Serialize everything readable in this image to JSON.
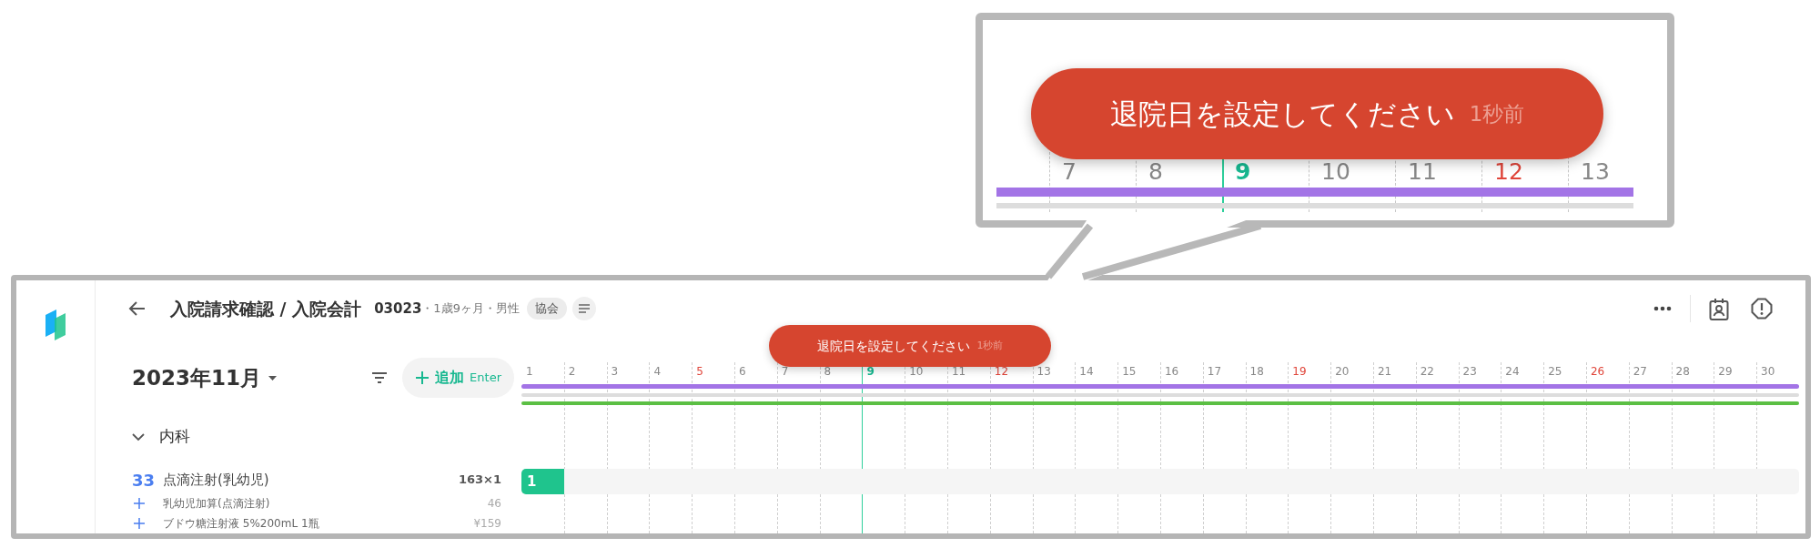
{
  "zoom_callout": {
    "toast": {
      "message": "退院日を設定してください",
      "time": "1秒前"
    },
    "days": [
      {
        "label": "7",
        "kind": "weekday"
      },
      {
        "label": "8",
        "kind": "weekday"
      },
      {
        "label": "9",
        "kind": "today"
      },
      {
        "label": "10",
        "kind": "weekday"
      },
      {
        "label": "11",
        "kind": "weekday"
      },
      {
        "label": "12",
        "kind": "holiday"
      },
      {
        "label": "13",
        "kind": "weekday"
      }
    ],
    "bars": [
      {
        "color": "#a374e6"
      },
      {
        "color": "#dddddd"
      }
    ]
  },
  "app": {
    "header": {
      "title": "入院請求確認 / 入院会計",
      "patient_id": "03023",
      "patient_info": "・1歳9ヶ月・男性",
      "badge": "協会"
    },
    "toast": {
      "message": "退院日を設定してください",
      "time": "1秒前"
    },
    "toolbar": {
      "month": "2023年11月",
      "add_button": {
        "label": "追加",
        "shortcut": "Enter"
      }
    },
    "days": [
      {
        "label": "1",
        "kind": "weekday"
      },
      {
        "label": "2",
        "kind": "weekday"
      },
      {
        "label": "3",
        "kind": "weekday"
      },
      {
        "label": "4",
        "kind": "weekday"
      },
      {
        "label": "5",
        "kind": "holiday"
      },
      {
        "label": "6",
        "kind": "weekday"
      },
      {
        "label": "7",
        "kind": "weekday"
      },
      {
        "label": "8",
        "kind": "weekday"
      },
      {
        "label": "9",
        "kind": "today"
      },
      {
        "label": "10",
        "kind": "weekday"
      },
      {
        "label": "11",
        "kind": "weekday"
      },
      {
        "label": "12",
        "kind": "holiday"
      },
      {
        "label": "13",
        "kind": "weekday"
      },
      {
        "label": "14",
        "kind": "weekday"
      },
      {
        "label": "15",
        "kind": "weekday"
      },
      {
        "label": "16",
        "kind": "weekday"
      },
      {
        "label": "17",
        "kind": "weekday"
      },
      {
        "label": "18",
        "kind": "weekday"
      },
      {
        "label": "19",
        "kind": "holiday"
      },
      {
        "label": "20",
        "kind": "weekday"
      },
      {
        "label": "21",
        "kind": "weekday"
      },
      {
        "label": "22",
        "kind": "weekday"
      },
      {
        "label": "23",
        "kind": "weekday"
      },
      {
        "label": "24",
        "kind": "weekday"
      },
      {
        "label": "25",
        "kind": "weekday"
      },
      {
        "label": "26",
        "kind": "holiday"
      },
      {
        "label": "27",
        "kind": "weekday"
      },
      {
        "label": "28",
        "kind": "weekday"
      },
      {
        "label": "29",
        "kind": "weekday"
      },
      {
        "label": "30",
        "kind": "weekday"
      }
    ],
    "bars": [
      {
        "color": "#a374e6"
      },
      {
        "color": "#dddddd"
      },
      {
        "color": "#5bbf44"
      }
    ],
    "sections": [
      {
        "title": "内科",
        "expanded": true,
        "items": [
          {
            "code": "33",
            "name": "点滴注射(乳幼児)",
            "amount": "163×1",
            "bar": {
              "label": "1"
            },
            "children": [
              {
                "name": "乳幼児加算(点滴注射)",
                "amount": "46"
              },
              {
                "name": "ブドウ糖注射液 5%200mL 1瓶",
                "amount": "¥159"
              }
            ]
          }
        ]
      }
    ]
  }
}
